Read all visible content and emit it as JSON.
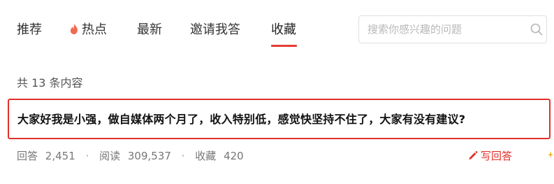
{
  "nav": {
    "tabs": [
      {
        "label": "推荐"
      },
      {
        "label": "热点"
      },
      {
        "label": "最新"
      },
      {
        "label": "邀请我答"
      },
      {
        "label": "收藏"
      }
    ],
    "active_tab": "收藏"
  },
  "search": {
    "placeholder": "搜索你感兴趣的问题",
    "value": ""
  },
  "collection": {
    "count_label": "共 13 条内容"
  },
  "question": {
    "title": "大家好我是小强，做自媒体两个月了，收入特别低，感觉快坚持不住了，大家有没有建议?",
    "answers_label": "回答",
    "answers": "2,451",
    "views_label": "阅读",
    "views": "309,537",
    "favorites_label": "收藏",
    "favorites": "420",
    "separator": "·",
    "write_answer": "写回答"
  },
  "colors": {
    "accent": "#e0312a",
    "fire": "#f06a50",
    "text_muted": "#777777"
  },
  "icons": {
    "hot": "fire-icon",
    "search": "search-icon",
    "write": "pen-icon"
  }
}
